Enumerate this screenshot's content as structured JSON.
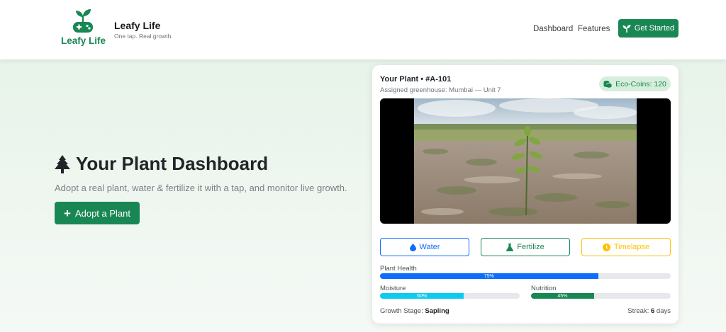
{
  "brand": {
    "logo_text": "Leafy Life",
    "name": "Leafy Life",
    "tagline": "One tap. Real growth.",
    "logo_icon": "sprout-gamepad-icon"
  },
  "nav": {
    "dashboard": "Dashboard",
    "features": "Features",
    "get_started": "Get Started"
  },
  "hero": {
    "title": "Your Plant Dashboard",
    "title_icon": "tree-icon",
    "subtitle": "Adopt a real plant, water & fertilize it with a tap, and monitor live growth.",
    "adopt_button": "Adopt a Plant"
  },
  "plant": {
    "title": "Your Plant • #A-101",
    "greenhouse": "Assigned greenhouse: Mumbai — Unit 7",
    "coins": "Eco-Coins: 120",
    "actions": {
      "water": "Water",
      "fertilize": "Fertilize",
      "timelapse": "Timelapse"
    },
    "health": {
      "label": "Plant Health",
      "value": 75,
      "text": "75%"
    },
    "moisture": {
      "label": "Moisture",
      "value": 60,
      "text": "60%"
    },
    "nutrition": {
      "label": "Nutrition",
      "value": 45,
      "text": "45%"
    },
    "growth_label": "Growth Stage:",
    "growth_stage": "Sapling",
    "streak_label": "Streak:",
    "streak_value": "6",
    "streak_unit": "days"
  },
  "colors": {
    "brand_green": "#198754",
    "primary_blue": "#0d6efd",
    "info_cyan": "#0dcaf0",
    "warning_yellow": "#ffc107"
  }
}
